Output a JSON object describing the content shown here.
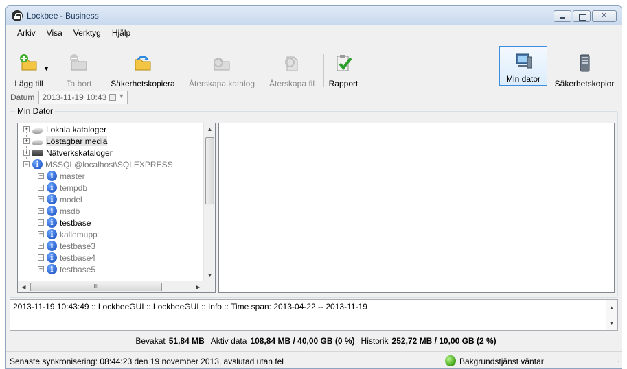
{
  "window": {
    "title": "Lockbee - Business"
  },
  "menu": [
    "Arkiv",
    "Visa",
    "Verktyg",
    "Hjälp"
  ],
  "toolbar": {
    "add": "Lägg till",
    "remove": "Ta bort",
    "backup": "Säkerhetskopiera",
    "restore_dir": "Återskapa katalog",
    "restore_file": "Återskapa fil",
    "report": "Rapport",
    "my_computer": "Min dator",
    "backups": "Säkerhetskopior"
  },
  "datum": {
    "label": "Datum",
    "value": "2013-11-19 10:43"
  },
  "group": {
    "title": "Min Dator"
  },
  "tree": {
    "roots": [
      {
        "label": "Lokala kataloger"
      },
      {
        "label": "Löstagbar media"
      },
      {
        "label": "Nätverkskataloger"
      },
      {
        "label": "MSSQL@localhost\\SQLEXPRESS"
      }
    ],
    "databases": [
      "master",
      "tempdb",
      "model",
      "msdb",
      "testbase",
      "kallemupp",
      "testbase3",
      "testbase4",
      "testbase5"
    ]
  },
  "log": {
    "line": "2013-11-19 10:43:49 :: LockbeeGUI :: LockbeeGUI :: Info :: Time span: 2013-04-22 -- 2013-11-19"
  },
  "stats": {
    "watched_label": "Bevakat",
    "watched_value": "51,84 MB",
    "active_label": "Aktiv data",
    "active_value": "108,84 MB / 40,00 GB (0 %)",
    "history_label": "Historik",
    "history_value": "252,72 MB / 10,00 GB (2 %)"
  },
  "status": {
    "last_sync": "Senaste synkronisering: 08:44:23 den 19 november 2013, avslutad utan fel",
    "service": "Bakgrundstjänst väntar",
    "service_color": "#3ca014"
  }
}
